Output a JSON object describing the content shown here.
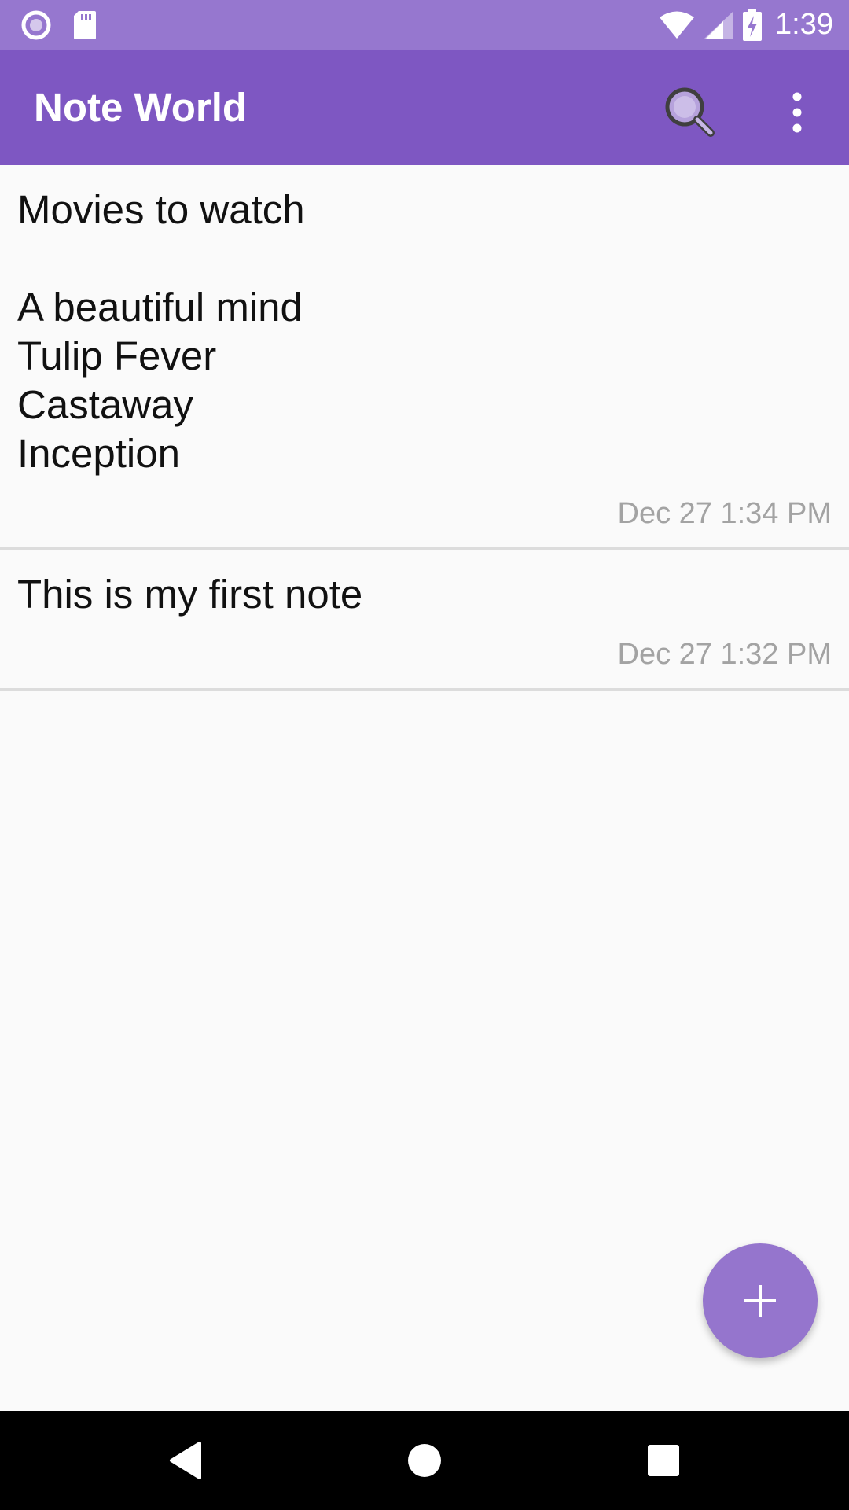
{
  "status_bar": {
    "time": "1:39",
    "left_icons": [
      "record-icon",
      "sd-card-icon"
    ],
    "right_icons": [
      "wifi-icon",
      "cell-signal-icon",
      "battery-charging-icon"
    ]
  },
  "app_bar": {
    "title": "Note World",
    "actions": [
      "search-icon",
      "more-vert-icon"
    ]
  },
  "notes": [
    {
      "text": "Movies to watch\n\nA beautiful mind\nTulip Fever\nCastaway\nInception",
      "date": "Dec 27 1:34 PM"
    },
    {
      "text": "This is my first note",
      "date": "Dec 27 1:32 PM"
    }
  ],
  "fab": {
    "icon": "add-icon"
  },
  "nav_bar": {
    "buttons": [
      "back-icon",
      "home-icon",
      "recents-icon"
    ]
  },
  "colors": {
    "status_bar": "#9677cf",
    "app_bar": "#7e57c2",
    "fab": "#9575cd",
    "background": "#fafafa",
    "date_text": "#a3a3a3"
  }
}
